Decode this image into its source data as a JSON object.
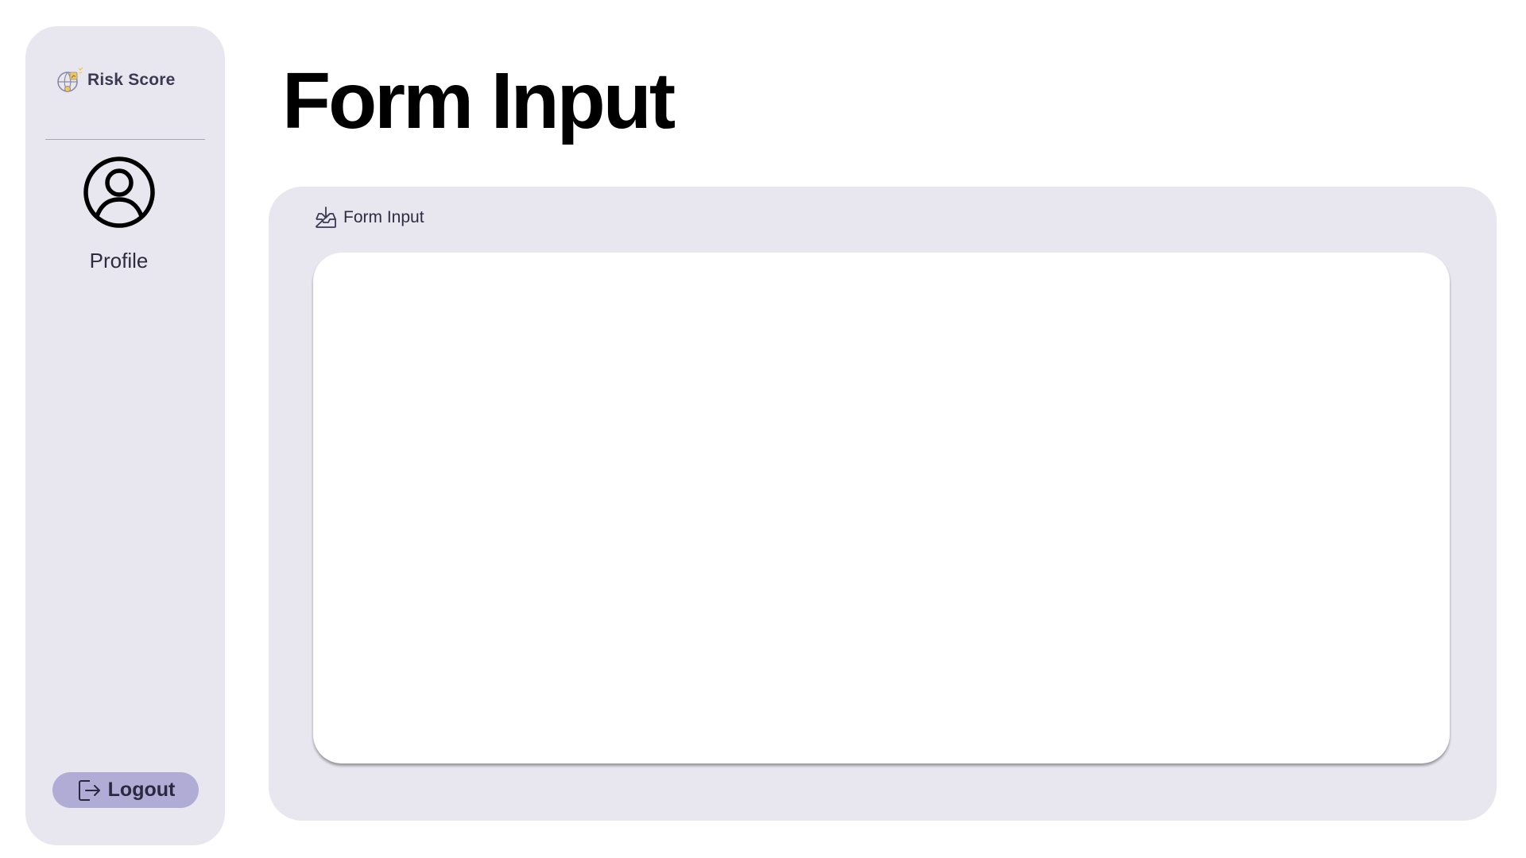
{
  "sidebar": {
    "brand": {
      "label": "Risk Score",
      "icon": "risk-score-logo-icon",
      "accent_color": "#f2c94c"
    },
    "profile": {
      "label": "Profile",
      "icon": "user-circle-icon"
    },
    "logout": {
      "label": "Logout",
      "icon": "logout-icon",
      "color": "#b1acd6"
    }
  },
  "main": {
    "title": "Form Input",
    "panel": {
      "title": "Form Input",
      "icon": "inbox-download-icon"
    }
  },
  "colors": {
    "panel_background": "#e8e7ef",
    "card_background": "#ffffff",
    "text_primary": "#2e2c40"
  }
}
